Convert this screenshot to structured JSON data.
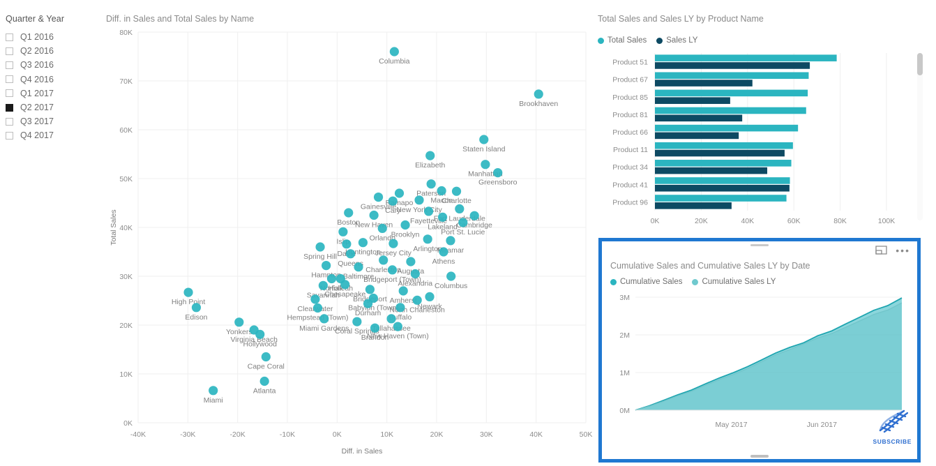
{
  "slicer": {
    "title": "Quarter & Year",
    "items": [
      {
        "label": "Q1 2016",
        "selected": false
      },
      {
        "label": "Q2 2016",
        "selected": false
      },
      {
        "label": "Q3 2016",
        "selected": false
      },
      {
        "label": "Q4 2016",
        "selected": false
      },
      {
        "label": "Q1 2017",
        "selected": false
      },
      {
        "label": "Q2 2017",
        "selected": true
      },
      {
        "label": "Q3 2017",
        "selected": false
      },
      {
        "label": "Q4 2017",
        "selected": false
      }
    ]
  },
  "colors": {
    "teal": "#2BB5C0",
    "teal_light": "#6FC9CE",
    "navy": "#0D4A63",
    "selection_blue": "#1F78D1",
    "grid": "#EFEFEF",
    "text": "#808080"
  },
  "area_visual_header": {
    "focus_icon": "focus-mode-icon",
    "more_icon": "more-options-icon",
    "more_glyph": "•••"
  },
  "watermark": {
    "text": "SUBSCRIBE",
    "icon": "dna-helix-icon"
  },
  "chart_data": [
    {
      "id": "scatter",
      "type": "scatter",
      "title": "Diff. in Sales and Total Sales by Name",
      "xlabel": "Diff. in Sales",
      "ylabel": "Total Sales",
      "xlim": [
        -40000,
        50000
      ],
      "ylim": [
        0,
        80000
      ],
      "xticks": [
        "-40K",
        "-30K",
        "-20K",
        "-10K",
        "0K",
        "10K",
        "20K",
        "30K",
        "40K",
        "50K"
      ],
      "yticks": [
        "0K",
        "10K",
        "20K",
        "30K",
        "40K",
        "50K",
        "60K",
        "70K",
        "80K"
      ],
      "xtickvals": [
        -40000,
        -30000,
        -20000,
        -10000,
        0,
        10000,
        20000,
        30000,
        40000,
        50000
      ],
      "ytickvals": [
        0,
        10000,
        20000,
        30000,
        40000,
        50000,
        60000,
        70000,
        80000
      ],
      "grid": true,
      "legend": "none",
      "points": [
        {
          "name": "Columbia",
          "x": 11500,
          "y": 76000
        },
        {
          "name": "Brookhaven",
          "x": 40500,
          "y": 67300
        },
        {
          "name": "Staten Island",
          "x": 29500,
          "y": 58000
        },
        {
          "name": "Manhattan",
          "x": 29800,
          "y": 52900
        },
        {
          "name": "Greensboro",
          "x": 32300,
          "y": 51200
        },
        {
          "name": "Elizabeth",
          "x": 18700,
          "y": 54700
        },
        {
          "name": "Paterson",
          "x": 18900,
          "y": 48900
        },
        {
          "name": "Macon",
          "x": 21000,
          "y": 47500
        },
        {
          "name": "Charlotte",
          "x": 24000,
          "y": 47400
        },
        {
          "name": "Ramapo",
          "x": 12500,
          "y": 47000
        },
        {
          "name": "New York City",
          "x": 16500,
          "y": 45600
        },
        {
          "name": "Gainesville",
          "x": 8300,
          "y": 46200
        },
        {
          "name": "Cary",
          "x": 11200,
          "y": 45400
        },
        {
          "name": "Fort Lauderdale",
          "x": 24600,
          "y": 43800
        },
        {
          "name": "Cambridge",
          "x": 27600,
          "y": 42400
        },
        {
          "name": "Fayetteville",
          "x": 18400,
          "y": 43300
        },
        {
          "name": "Lakeland",
          "x": 21200,
          "y": 42100
        },
        {
          "name": "Port St. Lucie",
          "x": 25300,
          "y": 41000
        },
        {
          "name": "Boston",
          "x": 2300,
          "y": 43000
        },
        {
          "name": "New Haven",
          "x": 7400,
          "y": 42500
        },
        {
          "name": "Brooklyn",
          "x": 13700,
          "y": 40500
        },
        {
          "name": "Orlando",
          "x": 9100,
          "y": 39800
        },
        {
          "name": "Islip",
          "x": 1200,
          "y": 39100
        },
        {
          "name": "Arlington",
          "x": 18200,
          "y": 37600
        },
        {
          "name": "Miramar",
          "x": 22800,
          "y": 37300
        },
        {
          "name": "Jersey City",
          "x": 11300,
          "y": 36700
        },
        {
          "name": "Huntington",
          "x": 5200,
          "y": 36900
        },
        {
          "name": "Davie",
          "x": 1900,
          "y": 36600
        },
        {
          "name": "Athens",
          "x": 21400,
          "y": 35000
        },
        {
          "name": "Spring Hill",
          "x": -3400,
          "y": 36000
        },
        {
          "name": "Queens",
          "x": 2700,
          "y": 34600
        },
        {
          "name": "Charleston",
          "x": 9300,
          "y": 33300
        },
        {
          "name": "Augusta",
          "x": 14800,
          "y": 33000
        },
        {
          "name": "Hampton",
          "x": -2200,
          "y": 32200
        },
        {
          "name": "Baltimore",
          "x": 4300,
          "y": 31900
        },
        {
          "name": "Bridgeport (Town)",
          "x": 11100,
          "y": 31300
        },
        {
          "name": "Alexandria",
          "x": 15700,
          "y": 30500
        },
        {
          "name": "Columbus",
          "x": 22900,
          "y": 30000
        },
        {
          "name": "Norfolk",
          "x": -1100,
          "y": 29500
        },
        {
          "name": "Hialeah",
          "x": 700,
          "y": 29500
        },
        {
          "name": "Chesapeake",
          "x": 1600,
          "y": 28300
        },
        {
          "name": "Savannah",
          "x": -2800,
          "y": 28100
        },
        {
          "name": "Bridgeport",
          "x": 6600,
          "y": 27300
        },
        {
          "name": "Amherst",
          "x": 13300,
          "y": 27000
        },
        {
          "name": "Babylon (Town)",
          "x": 7300,
          "y": 25500
        },
        {
          "name": "Newark",
          "x": 18600,
          "y": 25800
        },
        {
          "name": "North Charleston",
          "x": 16100,
          "y": 25100
        },
        {
          "name": "Durham",
          "x": 6200,
          "y": 24400
        },
        {
          "name": "Buffalo",
          "x": 12700,
          "y": 23600
        },
        {
          "name": "Clearwater",
          "x": -4400,
          "y": 25300
        },
        {
          "name": "High Point",
          "x": -29900,
          "y": 26700
        },
        {
          "name": "Hempstead (Town)",
          "x": -3900,
          "y": 23500
        },
        {
          "name": "Edison",
          "x": -28300,
          "y": 23600
        },
        {
          "name": "Miami Gardens",
          "x": -2600,
          "y": 21300
        },
        {
          "name": "Tallahassee",
          "x": 10900,
          "y": 21300
        },
        {
          "name": "Coral Springs",
          "x": 4000,
          "y": 20700
        },
        {
          "name": "New Haven (Town)",
          "x": 12200,
          "y": 19700
        },
        {
          "name": "Yonkers",
          "x": -19700,
          "y": 20600
        },
        {
          "name": "Brandon",
          "x": 7600,
          "y": 19400
        },
        {
          "name": "Virginia Beach",
          "x": -16700,
          "y": 19000
        },
        {
          "name": "Hollywood",
          "x": -15500,
          "y": 18100
        },
        {
          "name": "Cape Coral",
          "x": -14300,
          "y": 13500
        },
        {
          "name": "Atlanta",
          "x": -14600,
          "y": 8500
        },
        {
          "name": "Miami",
          "x": -24900,
          "y": 6600
        }
      ]
    },
    {
      "id": "bar",
      "type": "bar",
      "orientation": "horizontal",
      "title": "Total Sales and Sales LY by Product Name",
      "categories": [
        "Product 51",
        "Product 67",
        "Product 85",
        "Product 81",
        "Product 66",
        "Product 11",
        "Product 34",
        "Product 41",
        "Product 96"
      ],
      "series": [
        {
          "name": "Total Sales",
          "color": "#2BB5C0",
          "values": [
            78500,
            66400,
            66000,
            65300,
            61800,
            59600,
            58900,
            58300,
            56800
          ]
        },
        {
          "name": "Sales LY",
          "color": "#0D4A63",
          "values": [
            66900,
            42100,
            32500,
            37700,
            36200,
            56000,
            48500,
            58100,
            33100
          ]
        }
      ],
      "xticks": [
        "0K",
        "20K",
        "40K",
        "60K",
        "80K",
        "100K"
      ],
      "xtickvals": [
        0,
        20000,
        40000,
        60000,
        80000,
        100000
      ],
      "xlim": [
        0,
        100000
      ],
      "grid": true,
      "legend": "top-left",
      "scrollbar": "vertical"
    },
    {
      "id": "area",
      "type": "area",
      "title": "Cumulative Sales and Cumulative Sales LY by Date",
      "series": [
        {
          "name": "Cumulative Sales",
          "color": "#2BB5C0",
          "values": [
            0,
            120000,
            260000,
            400000,
            540000,
            700000,
            850000,
            1010000,
            1160000,
            1330000,
            1500000,
            1680000,
            1790000,
            1960000,
            2130000,
            2300000,
            2460000,
            2620000,
            2800000,
            2980000
          ]
        },
        {
          "name": "Cumulative Sales LY",
          "color": "#6FC9CE",
          "values": [
            0,
            105000,
            235000,
            375000,
            505000,
            660000,
            805000,
            960000,
            1110000,
            1280000,
            1450000,
            1620000,
            1760000,
            1900000,
            2060000,
            2210000,
            2360000,
            2510000,
            2680000,
            2850000
          ]
        }
      ],
      "yticks": [
        "0M",
        "1M",
        "2M",
        "3M"
      ],
      "ytickvals": [
        0,
        1000000,
        2000000,
        3000000
      ],
      "ylim": [
        0,
        3000000
      ],
      "xticks": [
        "May 2017",
        "Jun 2017"
      ],
      "grid": true,
      "legend": "top-left",
      "selected": true
    }
  ]
}
